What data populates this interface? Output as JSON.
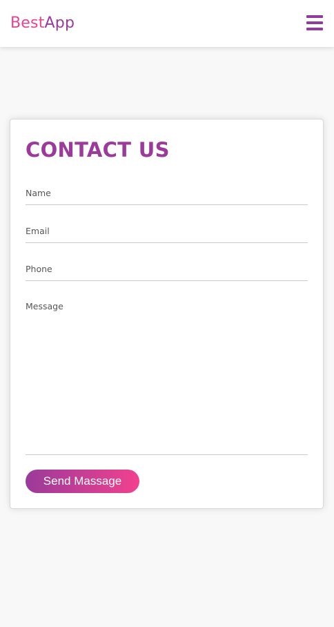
{
  "header": {
    "brand_part1": "Best",
    "brand_part2": "App",
    "menu_icon": "hamburger-menu-icon"
  },
  "contact": {
    "title": "CONTACT US",
    "fields": {
      "name_placeholder": "Name",
      "email_placeholder": "Email",
      "phone_placeholder": "Phone",
      "message_placeholder": "Message"
    },
    "submit_label": "Send Massage"
  },
  "colors": {
    "brand_pink": "#e84393",
    "brand_purple": "#9b3a9a",
    "button_gradient_start": "#9b3a9a",
    "button_gradient_end": "#f2418e",
    "page_background": "#f8f8f8"
  }
}
